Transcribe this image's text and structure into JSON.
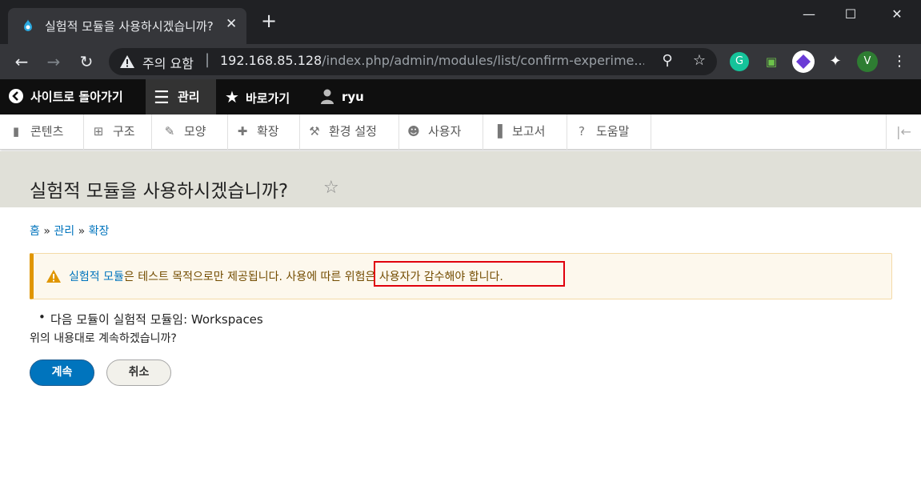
{
  "browser": {
    "tab_title": "실험적 모듈을 사용하시겠습니까?",
    "security_label": "주의 요함",
    "url_host": "192.168.85.128",
    "url_path": "/index.php/admin/modules/list/confirm-experime..."
  },
  "admin_toolbar": {
    "back_to_site": "사이트로 돌아가기",
    "manage": "관리",
    "shortcuts": "바로가기",
    "user": "ryu"
  },
  "tray": {
    "items": [
      {
        "label": "콘텐츠",
        "icon": "file-icon"
      },
      {
        "label": "구조",
        "icon": "sitemap-icon"
      },
      {
        "label": "모양",
        "icon": "brush-icon"
      },
      {
        "label": "확장",
        "icon": "puzzle-icon"
      },
      {
        "label": "환경 설정",
        "icon": "wrench-icon"
      },
      {
        "label": "사용자",
        "icon": "people-icon"
      },
      {
        "label": "보고서",
        "icon": "bar-chart-icon"
      },
      {
        "label": "도움말",
        "icon": "help-icon"
      }
    ]
  },
  "page": {
    "title": "실험적 모듈을 사용하시겠습니까?",
    "breadcrumb": [
      "홈",
      "관리",
      "확장"
    ],
    "breadcrumb_sep": "»",
    "warning_link": "실험적 모듈",
    "warning_text_1": "은 테스트 목적으로만 제공됩니다. 사용에 따른 ",
    "warning_text_2": "위험은 사용자가 감수해야 합니다.",
    "list_item": "다음 모듈이 실험적 모듈임: Workspaces",
    "question": "위의 내용대로 계속하겠습니까?",
    "continue_button": "계속",
    "cancel_button": "취소"
  },
  "colors": {
    "accent": "#0074bd",
    "warning_border": "#e09600",
    "highlight": "#e0000c"
  }
}
